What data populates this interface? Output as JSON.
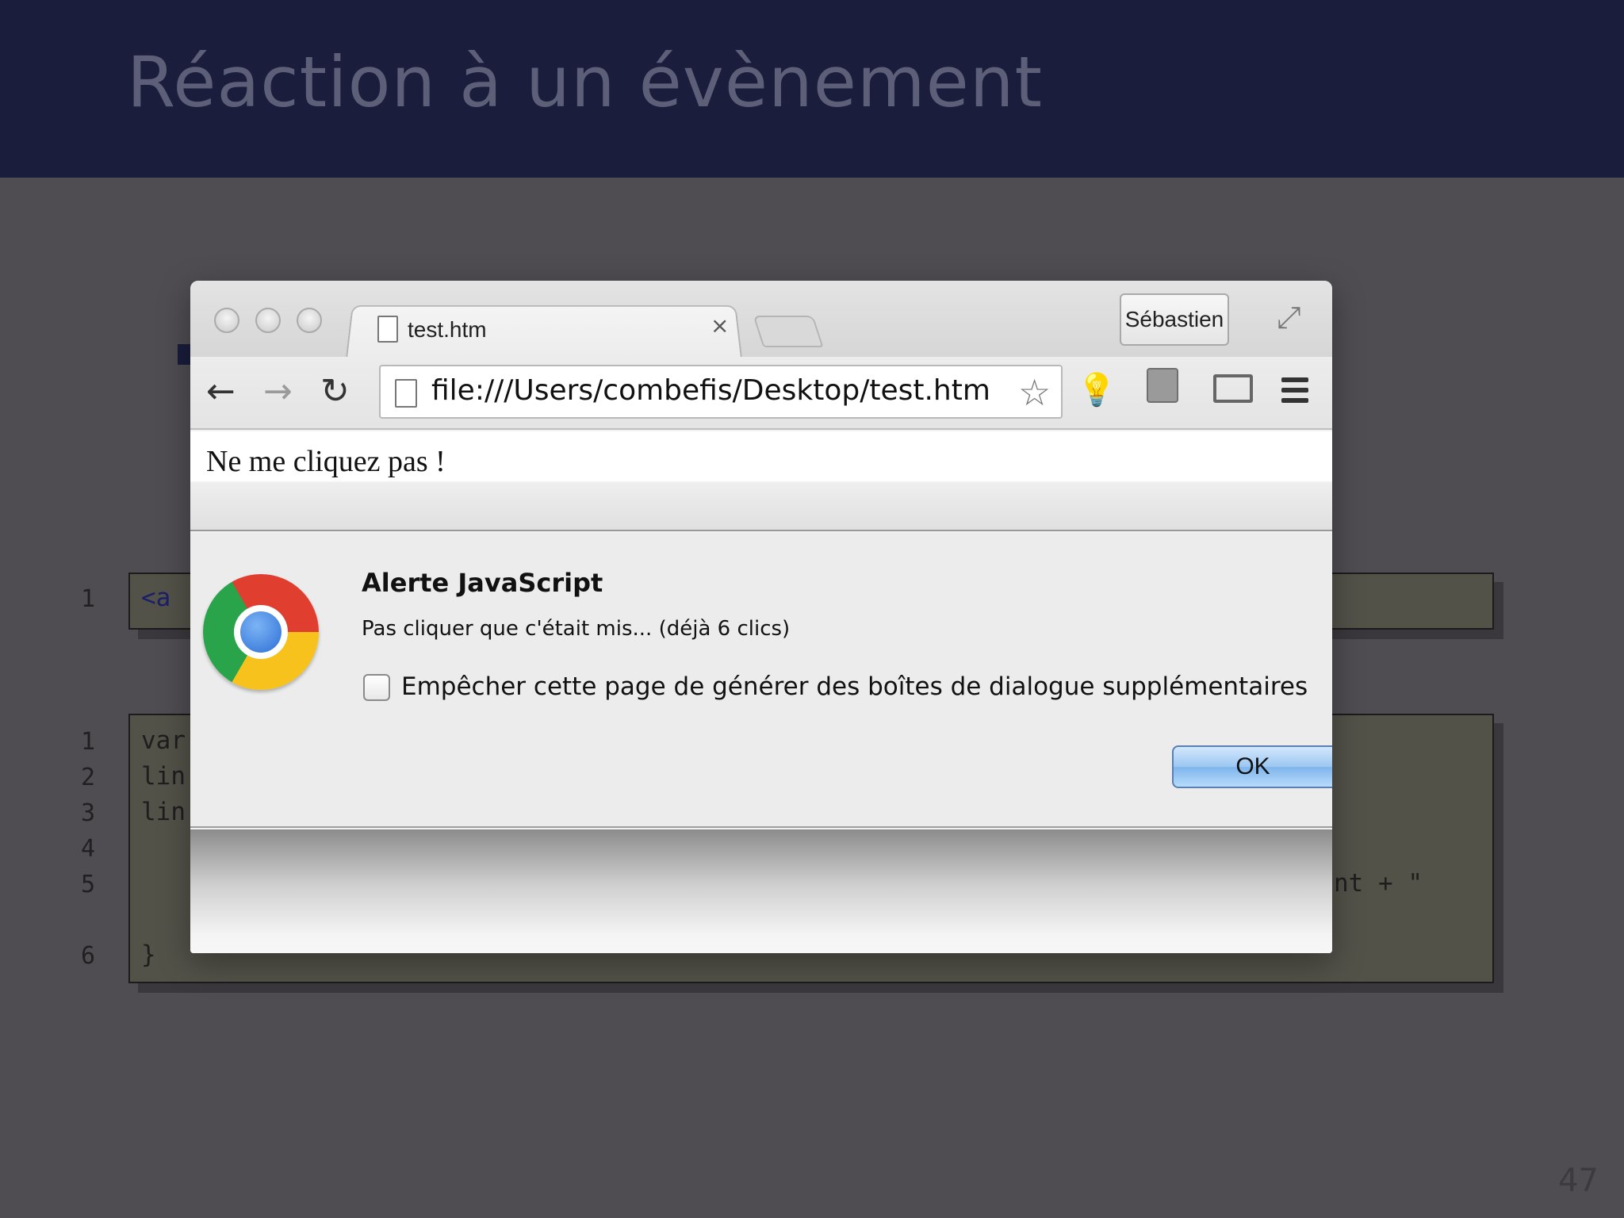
{
  "slide": {
    "title": "Réaction à un évènement",
    "page_number": "47",
    "code_snippet_1": {
      "line_number": "1",
      "visible_code": "<a"
    },
    "code_snippet_2": {
      "lines": [
        {
          "number": "1",
          "text": "var"
        },
        {
          "number": "2",
          "text": "lin"
        },
        {
          "number": "3",
          "text": "lin"
        },
        {
          "number": "4",
          "text": ""
        },
        {
          "number": "5",
          "text": "nt + \""
        },
        {
          "number": "6",
          "text": "}"
        }
      ]
    }
  },
  "browser": {
    "tab_title": "test.htm",
    "tab_close": "×",
    "profile_button": "Sébastien",
    "url": "file:///Users/combefis/Desktop/test.htm",
    "page_link_text": "Ne me cliquez pas !",
    "icons": [
      "back-icon",
      "forward-icon",
      "reload-icon",
      "page-icon",
      "star-icon",
      "lightbulb-extension-icon",
      "evernote-extension-icon",
      "cast-icon",
      "menu-icon",
      "fullscreen-icon"
    ]
  },
  "alert": {
    "title": "Alerte JavaScript",
    "message": "Pas cliquer que c'était mis... (déjà 6 clics)",
    "checkbox_label": "Empêcher cette page de générer des boîtes de dialogue supplémentaires",
    "checkbox_checked": false,
    "ok_label": "OK"
  },
  "colors": {
    "slide_header": "#1a1d3b",
    "slide_background": "#4f4d52",
    "ok_button": "#9cc7f2"
  }
}
